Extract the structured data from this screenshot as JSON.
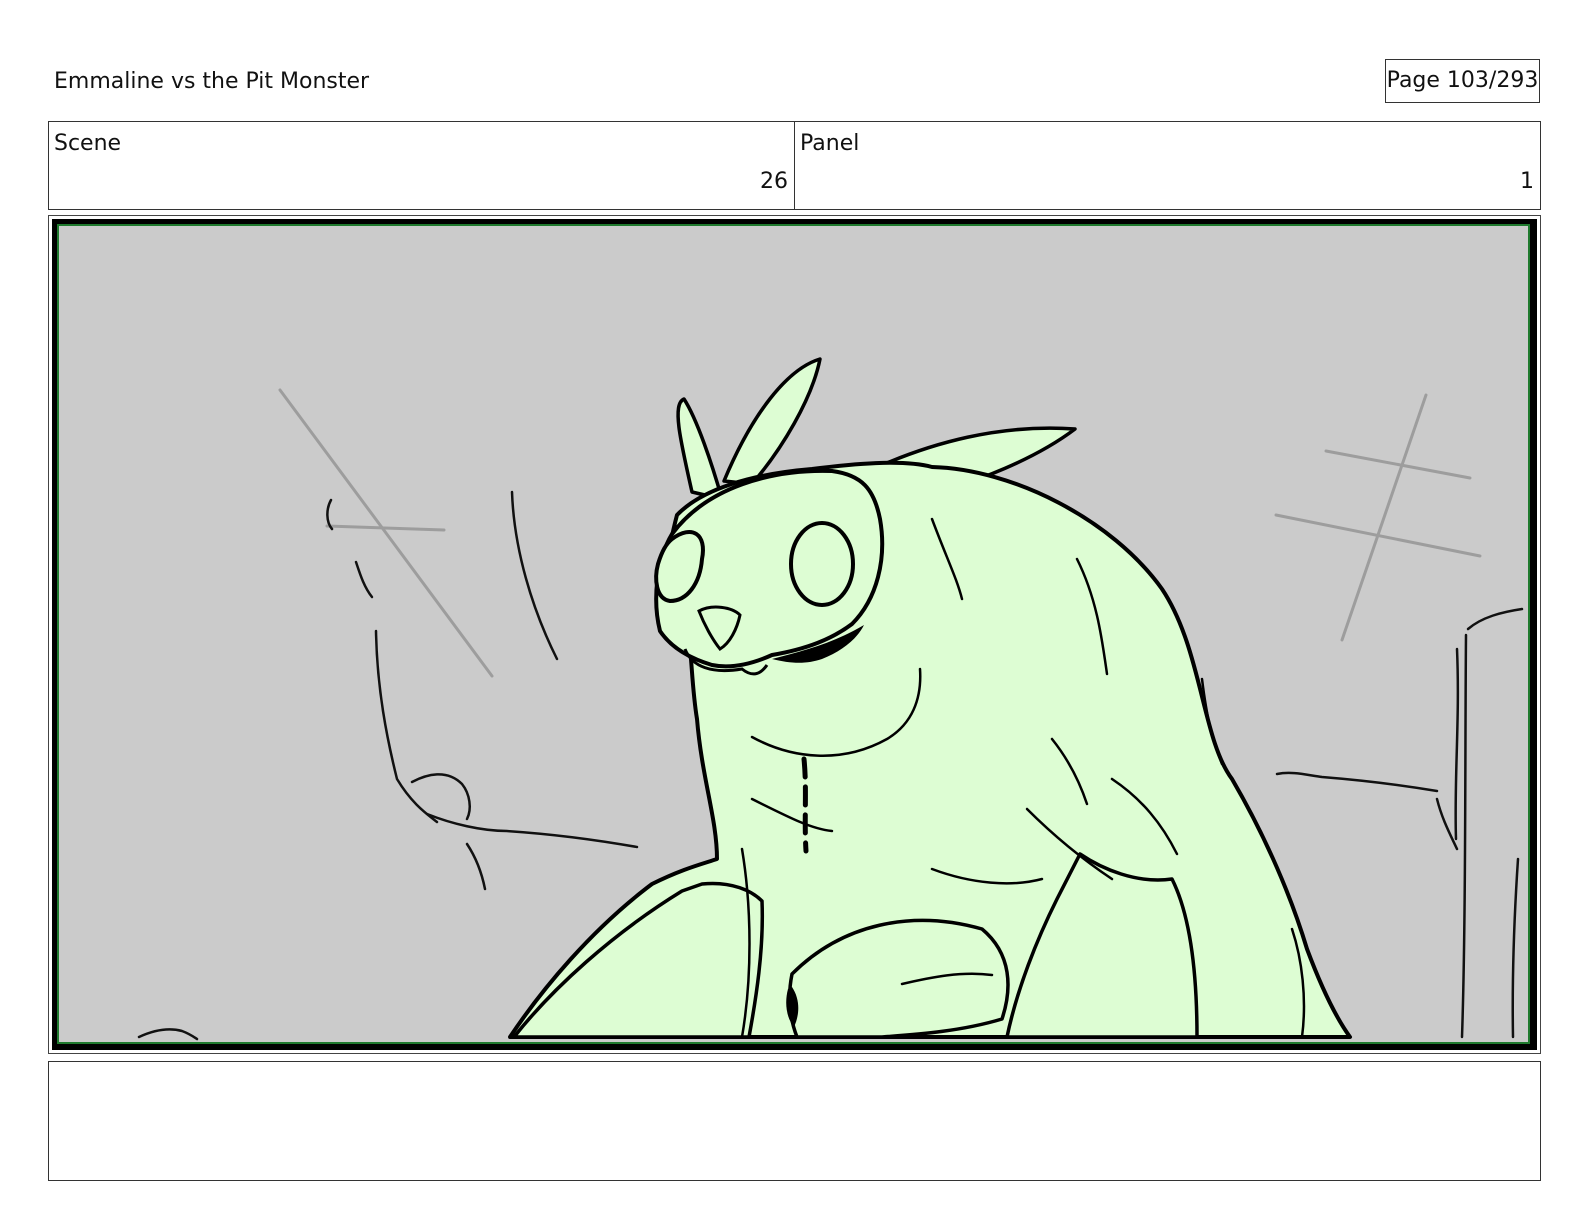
{
  "header": {
    "title": "Emmaline vs the Pit Monster",
    "page_label": "Page 103/293"
  },
  "info": {
    "scene_label": "Scene",
    "scene_value": "26",
    "panel_label": "Panel",
    "panel_value": "1"
  },
  "frame": {
    "background_color": "#cbcbcb",
    "border_color": "#1f7a2e",
    "monster_fill": "#ddfdd3",
    "line_color": "#000000"
  },
  "notes": {
    "text": ""
  }
}
